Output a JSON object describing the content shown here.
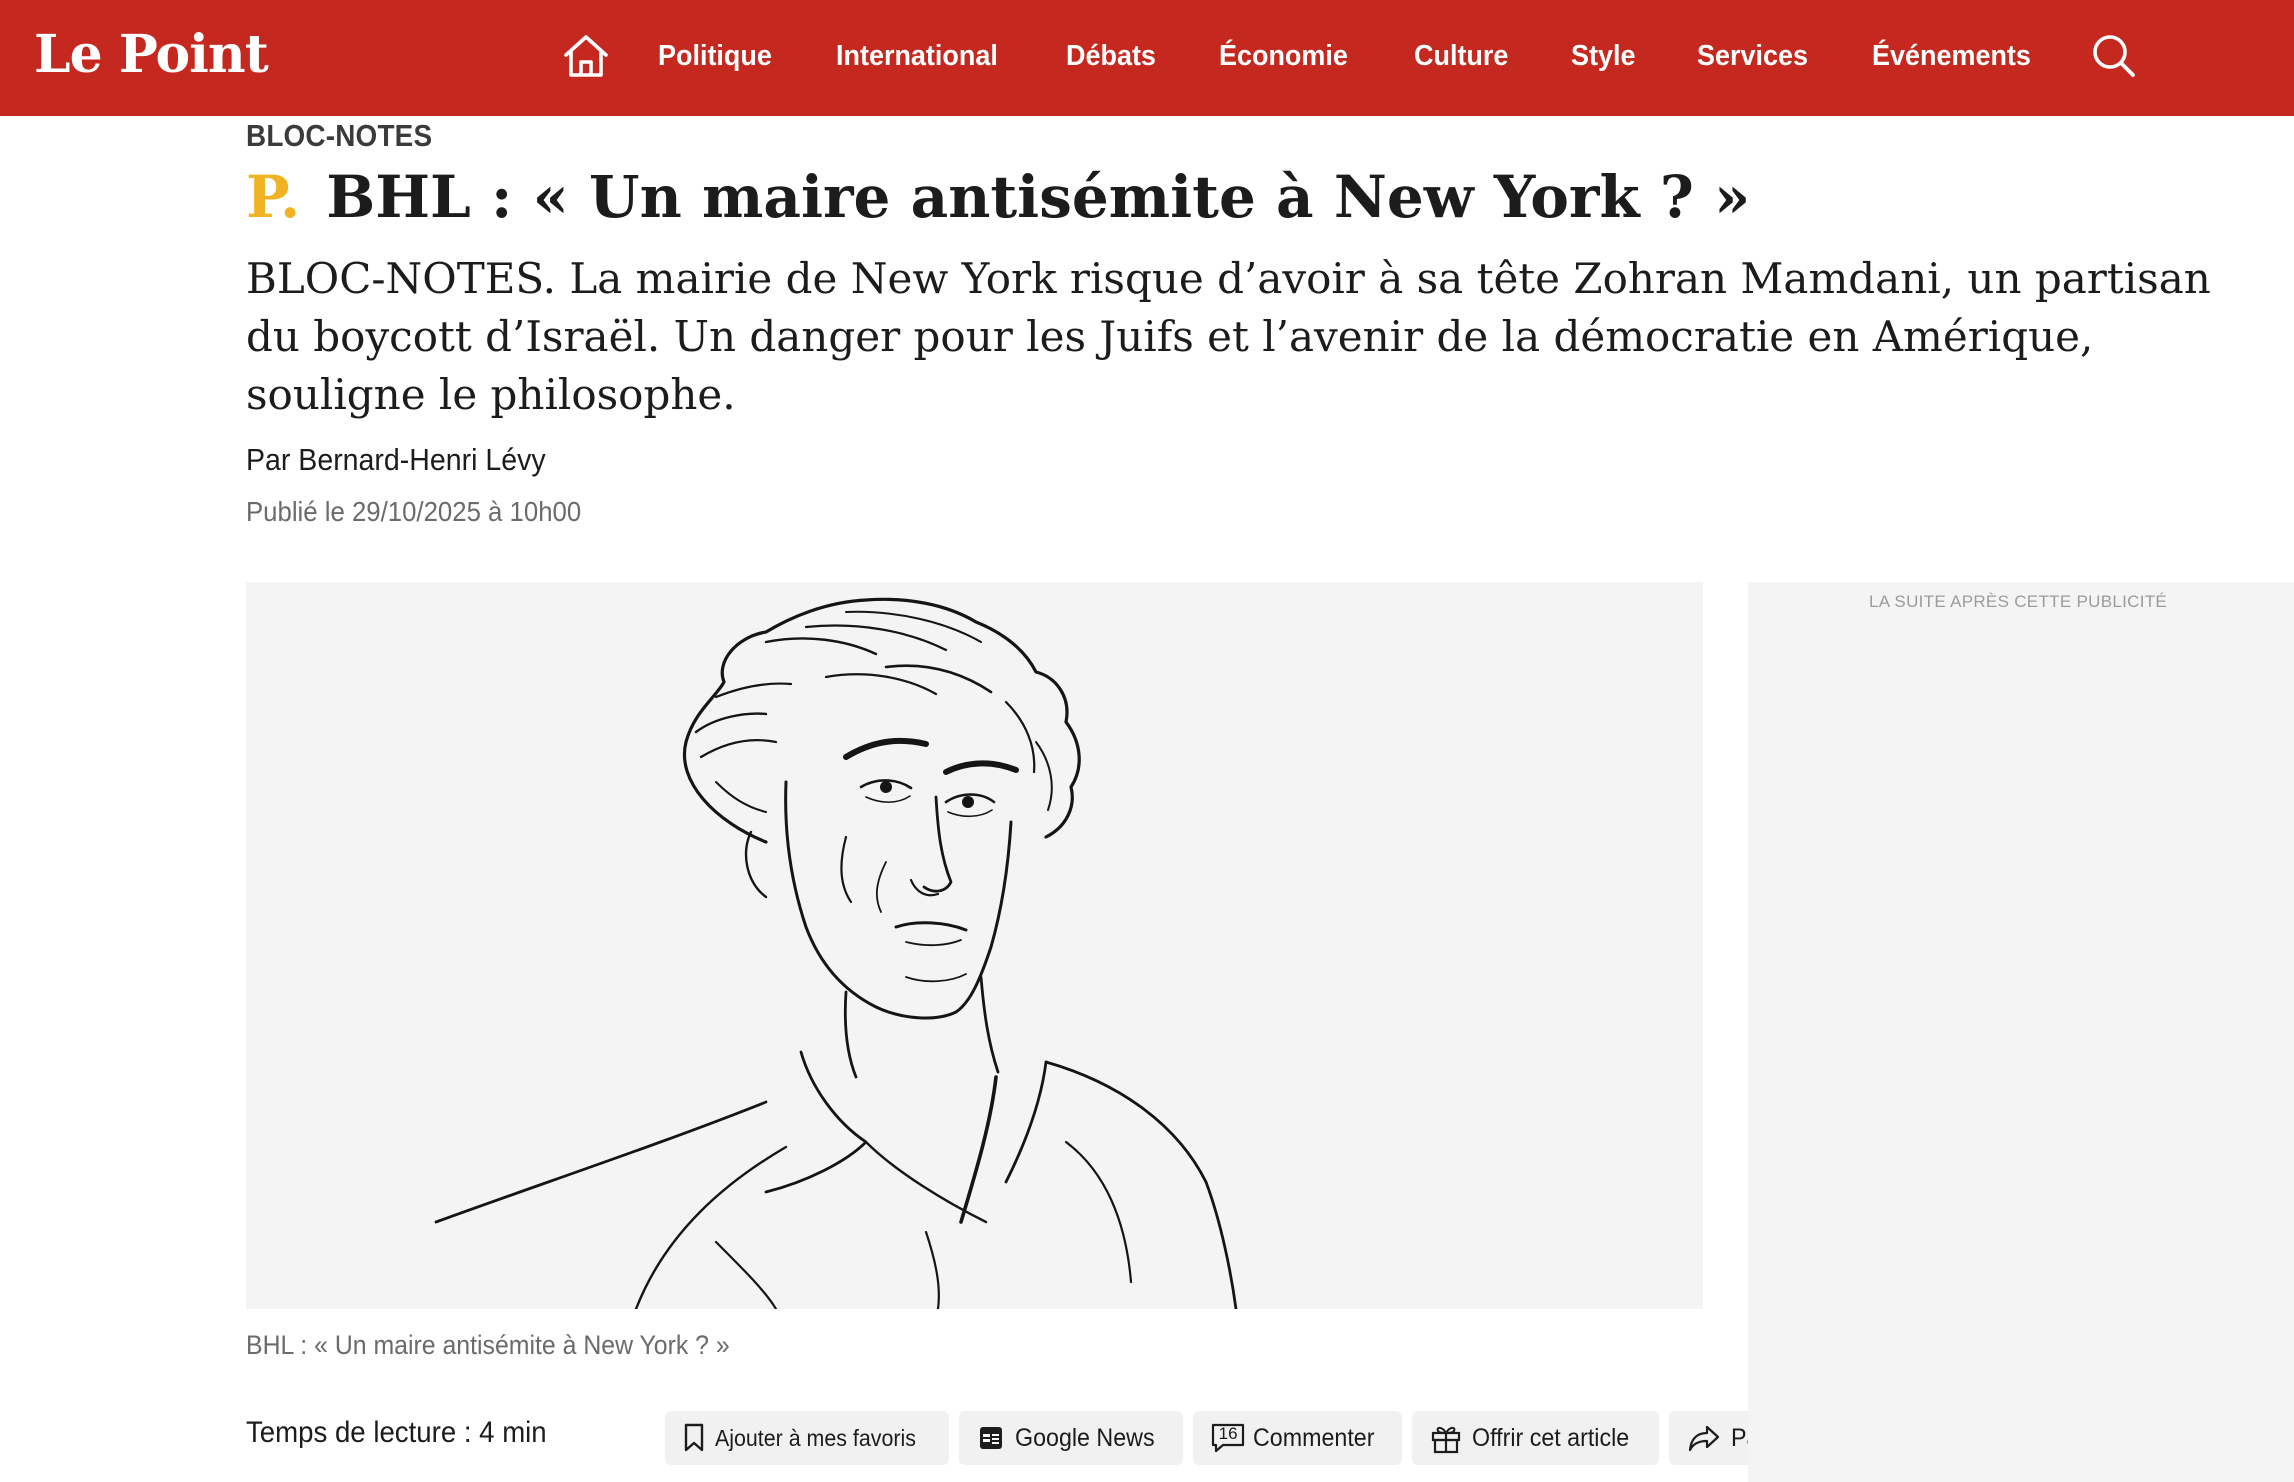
{
  "header": {
    "logo": "Le Point",
    "nav": [
      "Politique",
      "International",
      "Débats",
      "Économie",
      "Culture",
      "Style",
      "Services",
      "Événements"
    ],
    "icons": {
      "home": "home-icon",
      "search": "search-icon"
    },
    "colors": {
      "brand_red": "#c4281f",
      "premium_yellow": "#f0b323"
    }
  },
  "article": {
    "rubric": "BLOC-NOTES",
    "premium_mark": "P.",
    "headline": "BHL : « Un maire antisémite à New York ? »",
    "lede": "BLOC-NOTES. La mairie de New York risque d’avoir à sa tête Zohran Mamdani, un partisan du boycott d’Israël. Un danger pour les Juifs et l’avenir de la démocratie en Amérique, souligne le philosophe.",
    "byline": "Par Bernard-Henri Lévy",
    "published": "Publié le 29/10/2025 à 10h00",
    "caption": "BHL : « Un maire antisémite à New York ? »",
    "reading_time": "Temps de lecture : 4 min"
  },
  "actions": {
    "favorites": "Ajouter à mes favoris",
    "google_news": "Google News",
    "comment_count": "16",
    "comment": "Commenter",
    "gift": "Offrir cet article",
    "share": "Partager"
  },
  "ad": {
    "label": "LA SUITE APRÈS CETTE PUBLICITÉ"
  }
}
